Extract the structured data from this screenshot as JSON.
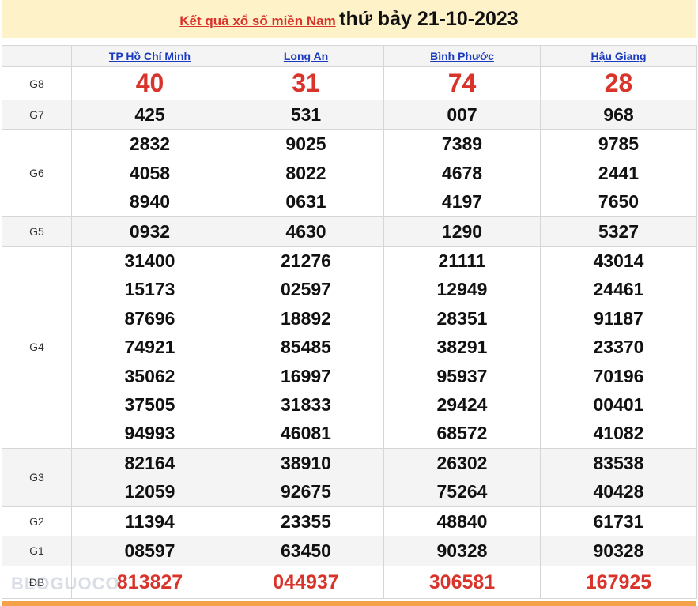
{
  "header": {
    "link_text": "Kết quả xổ số miền Nam",
    "date_text": "thứ bảy 21-10-2023"
  },
  "provinces": [
    "TP Hồ Chí Minh",
    "Long An",
    "Bình Phước",
    "Hậu Giang"
  ],
  "rows": [
    {
      "label": "G8",
      "values": [
        [
          "40"
        ],
        [
          "31"
        ],
        [
          "74"
        ],
        [
          "28"
        ]
      ]
    },
    {
      "label": "G7",
      "values": [
        [
          "425"
        ],
        [
          "531"
        ],
        [
          "007"
        ],
        [
          "968"
        ]
      ]
    },
    {
      "label": "G6",
      "values": [
        [
          "2832",
          "4058",
          "8940"
        ],
        [
          "9025",
          "8022",
          "0631"
        ],
        [
          "7389",
          "4678",
          "4197"
        ],
        [
          "9785",
          "2441",
          "7650"
        ]
      ]
    },
    {
      "label": "G5",
      "values": [
        [
          "0932"
        ],
        [
          "4630"
        ],
        [
          "1290"
        ],
        [
          "5327"
        ]
      ]
    },
    {
      "label": "G4",
      "values": [
        [
          "31400",
          "15173",
          "87696",
          "74921",
          "35062",
          "37505",
          "94993"
        ],
        [
          "21276",
          "02597",
          "18892",
          "85485",
          "16997",
          "31833",
          "46081"
        ],
        [
          "21111",
          "12949",
          "28351",
          "38291",
          "95937",
          "29424",
          "68572"
        ],
        [
          "43014",
          "24461",
          "91187",
          "23370",
          "70196",
          "00401",
          "41082"
        ]
      ]
    },
    {
      "label": "G3",
      "values": [
        [
          "82164",
          "12059"
        ],
        [
          "38910",
          "92675"
        ],
        [
          "26302",
          "75264"
        ],
        [
          "83538",
          "40428"
        ]
      ]
    },
    {
      "label": "G2",
      "values": [
        [
          "11394"
        ],
        [
          "23355"
        ],
        [
          "48840"
        ],
        [
          "61731"
        ]
      ]
    },
    {
      "label": "G1",
      "values": [
        [
          "08597"
        ],
        [
          "63450"
        ],
        [
          "90328"
        ],
        [
          "90328"
        ]
      ]
    },
    {
      "label": "ĐB",
      "values": [
        [
          "813827"
        ],
        [
          "044937"
        ],
        [
          "306581"
        ],
        [
          "167925"
        ]
      ]
    }
  ],
  "watermark": "BLOGUOCO"
}
